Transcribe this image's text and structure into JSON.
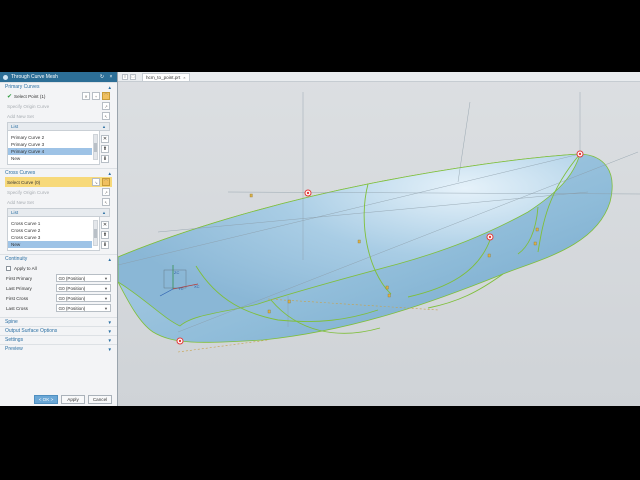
{
  "dialog": {
    "title": "Through Curve Mesh",
    "primary": {
      "header": "Primary Curves",
      "select_label": "Select Point (1)",
      "origin_label": "Specify Origin Curve",
      "add_set_label": "Add New Set",
      "list_header": "List",
      "items": [
        "Primary Curve  2",
        "Primary Curve  3",
        "Primary Curve  4",
        "New"
      ],
      "highlight_index": 2
    },
    "cross": {
      "header": "Cross Curves",
      "select_label": "Select Curve (0)",
      "origin_label": "Specify Origin Curve",
      "add_set_label": "Add New Set",
      "list_header": "List",
      "items": [
        "Cross Curve  1",
        "Cross Curve  2",
        "Cross Curve  3",
        "New"
      ],
      "highlight_index": 3
    },
    "continuity": {
      "header": "Continuity",
      "apply_all": "Apply to All",
      "rows": [
        {
          "label": "First Primary",
          "value": "G0 (Position)"
        },
        {
          "label": "Last Primary",
          "value": "G0 (Position)"
        },
        {
          "label": "First Cross",
          "value": "G0 (Position)"
        },
        {
          "label": "Last Cross",
          "value": "G0 (Position)"
        }
      ]
    },
    "collapsed_sections": [
      "Spine",
      "Output Surface Options",
      "Settings",
      "Preview"
    ],
    "buttons": {
      "ok": "< OK >",
      "apply": "Apply",
      "cancel": "Cancel"
    }
  },
  "viewport": {
    "tab_label": "hcm_to_point.prt",
    "axis_labels": {
      "zc": "ZC",
      "xc": "XC",
      "yc": "YC"
    }
  },
  "colors": {
    "title_bar": "#2c6e96",
    "section_text": "#2a6fa3",
    "selection_highlight": "#f7d97a",
    "list_highlight": "#9ec3e6",
    "surface_blue": "#9cc4de",
    "edge_green": "#7fbf3a",
    "point_marker": "#e23a3a"
  }
}
